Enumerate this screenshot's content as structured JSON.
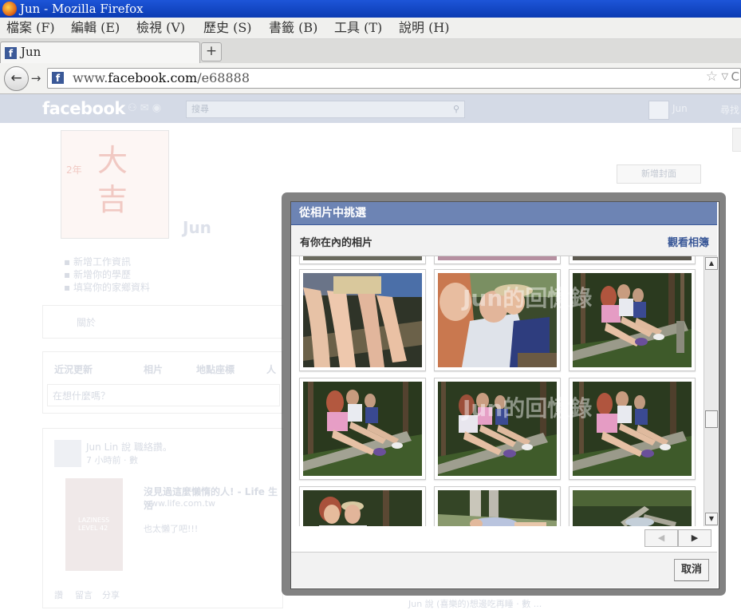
{
  "window": {
    "title": "Jun        - Mozilla Firefox"
  },
  "menu": [
    "檔案 (F)",
    "編輯 (E)",
    "檢視 (V)",
    "歷史 (S)",
    "書籤 (B)",
    "工具 (T)",
    "說明 (H)"
  ],
  "tab": {
    "label": "Jun",
    "favicon": "f",
    "new_tab": "+"
  },
  "nav": {
    "back_icon": "←",
    "forward_icon": "→",
    "url_prefix": "www.",
    "url_domain": "facebook.com",
    "url_path": "/e68888",
    "star_icon": "☆",
    "dropdown_icon": "▽",
    "reload_icon": "C"
  },
  "facebook": {
    "logo": "facebook",
    "search_placeholder": "搜尋",
    "user_name": "Jun",
    "home_label": "尋找",
    "cover_button": "新增封面",
    "profile_name": "Jun",
    "profile_pic_text": {
      "year": "2年",
      "line1": "大",
      "line2": "吉"
    },
    "info": [
      "新增工作資訊",
      "新增你的學歷",
      "填寫你的家鄉資料"
    ],
    "about": "關於",
    "tabs": [
      "近況更新",
      "相片",
      "地點座標",
      "人"
    ],
    "status_placeholder": "在想什麼嗎？",
    "post": {
      "author_line": "Jun Lin 說 職絡讚。",
      "time": "7 小時前 · 數",
      "link_title": "沒見過這麼懶惰的人! - Life 生活",
      "link_url": "www.life.com.tw",
      "link_desc": "也太懶了吧!!!",
      "image_text": [
        "LAZINESS",
        "LEVEL 42"
      ],
      "actions": [
        "讚",
        "留言",
        "分享"
      ]
    },
    "bottom_peek": "Jun 說 (喜樂的)想邊吃再睡 · 數 ..."
  },
  "dialog": {
    "title": "從相片中挑選",
    "subtitle": "有你在內的相片",
    "view_albums": "觀看相簿",
    "cancel": "取消",
    "pager": {
      "prev": "◀",
      "next": "▶"
    },
    "scroll": {
      "up": "▲",
      "down": "▼"
    },
    "watermark": "Jun的回憶錄",
    "photos": [
      {
        "kind": "legs"
      },
      {
        "kind": "selfie"
      },
      {
        "kind": "log"
      },
      {
        "kind": "log"
      },
      {
        "kind": "log"
      },
      {
        "kind": "log"
      },
      {
        "kind": "selfie-top"
      },
      {
        "kind": "lying"
      },
      {
        "kind": "forest-top"
      }
    ]
  }
}
